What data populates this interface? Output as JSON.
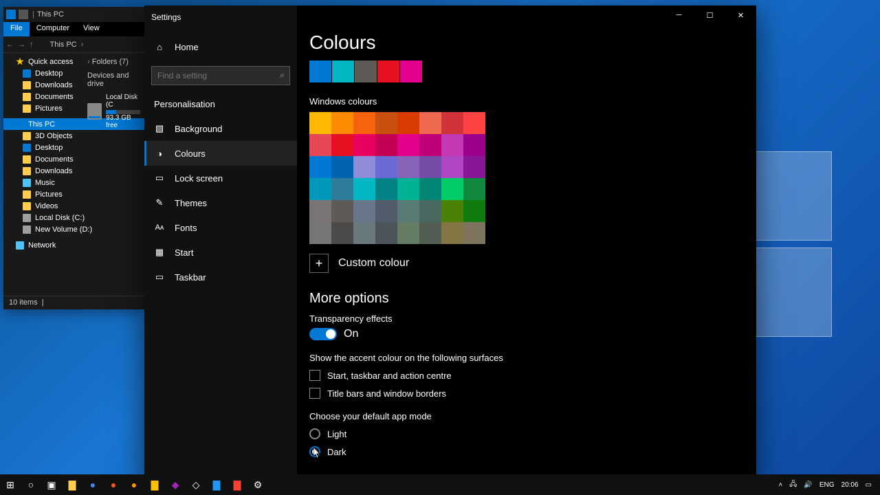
{
  "explorer": {
    "title": "This PC",
    "tabs": {
      "file": "File",
      "computer": "Computer",
      "view": "View"
    },
    "breadcrumb": "This PC",
    "tree": {
      "quick_access": "Quick access",
      "desktop": "Desktop",
      "downloads": "Downloads",
      "documents": "Documents",
      "pictures": "Pictures",
      "this_pc": "This PC",
      "objects3d": "3D Objects",
      "desktop2": "Desktop",
      "documents2": "Documents",
      "downloads2": "Downloads",
      "music": "Music",
      "pictures2": "Pictures",
      "videos": "Videos",
      "local_disk": "Local Disk (C:)",
      "new_volume": "New Volume (D:)",
      "network": "Network"
    },
    "content": {
      "folders_header": "Folders (7)",
      "drives_header": "Devices and drive",
      "drive_name": "Local Disk (C",
      "drive_free": "93.3 GB free"
    },
    "status": "10 items"
  },
  "settings": {
    "title": "Settings",
    "home": "Home",
    "search_placeholder": "Find a setting",
    "category": "Personalisation",
    "nav": {
      "background": "Background",
      "colours": "Colours",
      "lock_screen": "Lock screen",
      "themes": "Themes",
      "fonts": "Fonts",
      "start": "Start",
      "taskbar": "Taskbar"
    },
    "page_title": "Colours",
    "recent_colours": [
      "#0078d4",
      "#00b7c3",
      "#5d5a58",
      "#e81123",
      "#e3008c"
    ],
    "windows_colours_label": "Windows colours",
    "grid": [
      "#ffb900",
      "#ff8c00",
      "#f7630c",
      "#ca5010",
      "#da3b01",
      "#ef6950",
      "#d13438",
      "#ff4343",
      "#e74856",
      "#e81123",
      "#ea005e",
      "#c30052",
      "#e3008c",
      "#bf0077",
      "#c239b3",
      "#9a0089",
      "#0078d4",
      "#0063b1",
      "#8e8cd8",
      "#6b69d6",
      "#8764b8",
      "#744da9",
      "#b146c2",
      "#881798",
      "#0099bc",
      "#2d7d9a",
      "#00b7c3",
      "#038387",
      "#00b294",
      "#018574",
      "#00cc6a",
      "#10893e",
      "#7a7574",
      "#5d5a58",
      "#68768a",
      "#515c6b",
      "#567c73",
      "#486860",
      "#498205",
      "#107c10",
      "#767676",
      "#4c4a48",
      "#69797e",
      "#4a5459",
      "#647c64",
      "#525e54",
      "#847545",
      "#7e735f"
    ],
    "custom_colour": "Custom colour",
    "more_options": "More options",
    "transparency_label": "Transparency effects",
    "transparency_state": "On",
    "accent_surfaces_label": "Show the accent colour on the following surfaces",
    "chk_start": "Start, taskbar and action centre",
    "chk_titlebars": "Title bars and window borders",
    "app_mode_label": "Choose your default app mode",
    "radio_light": "Light",
    "radio_dark": "Dark"
  },
  "taskbar": {
    "lang": "ENG",
    "time": "20:06"
  }
}
